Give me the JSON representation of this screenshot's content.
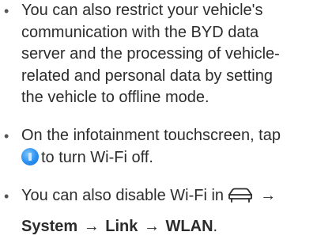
{
  "bullets": [
    {
      "lines": [
        "You can also restrict your vehicle's",
        "communication with the BYD data",
        "server and the processing of vehicle-",
        "related and personal data by setting",
        "the vehicle to offline mode."
      ]
    },
    {
      "line1": "On the infotainment touchscreen, tap",
      "line2_suffix": "to turn Wi-Fi off.",
      "icon": "wifi-toggle-icon"
    },
    {
      "line1": "You can also disable Wi-Fi in",
      "icon": "car-settings-icon",
      "arrow": "→",
      "path": [
        "System",
        "Link",
        "WLAN"
      ],
      "end": "."
    }
  ],
  "colors": {
    "text": "#2c2c2c",
    "icon_blue": "#2a8ff0"
  }
}
